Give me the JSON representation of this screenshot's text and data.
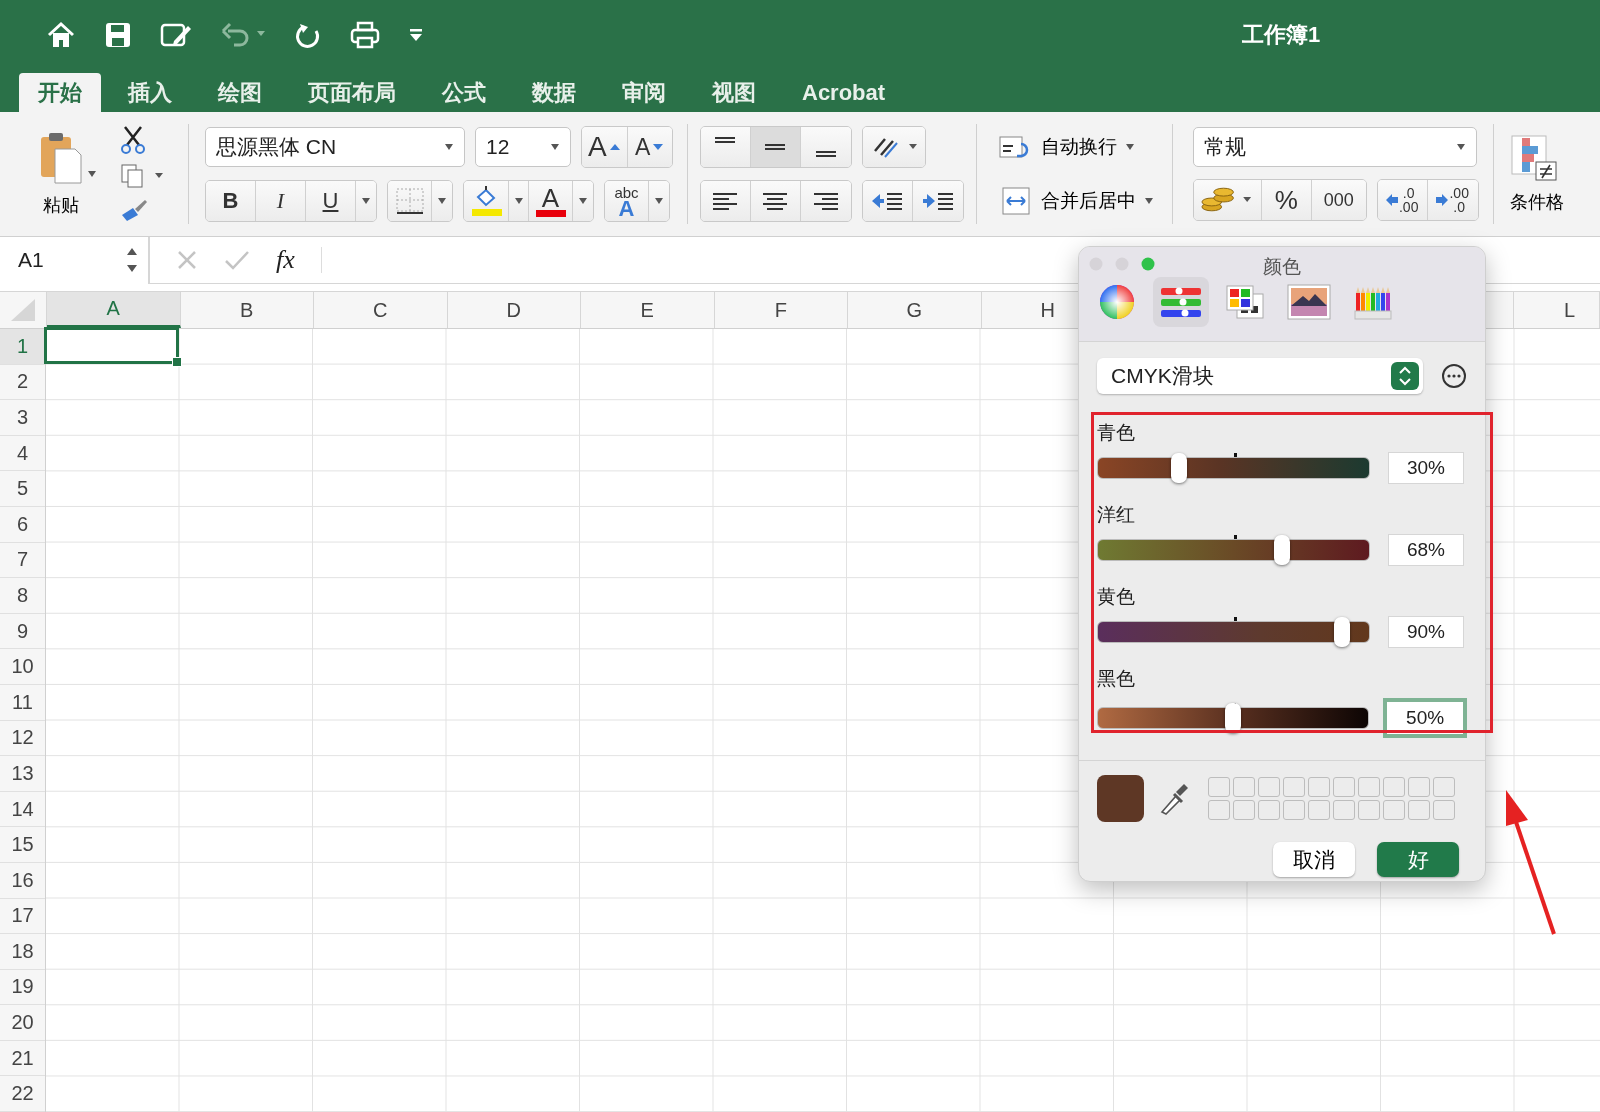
{
  "window": {
    "title": "工作簿1"
  },
  "tabs": [
    {
      "label": "开始",
      "selected": true
    },
    {
      "label": "插入",
      "selected": false
    },
    {
      "label": "绘图",
      "selected": false
    },
    {
      "label": "页面布局",
      "selected": false
    },
    {
      "label": "公式",
      "selected": false
    },
    {
      "label": "数据",
      "selected": false
    },
    {
      "label": "审阅",
      "selected": false
    },
    {
      "label": "视图",
      "selected": false
    },
    {
      "label": "Acrobat",
      "selected": false
    }
  ],
  "ribbon": {
    "paste_label": "粘贴",
    "font_name": "思源黑体 CN",
    "font_size": "12",
    "grow_font": "A",
    "shrink_font": "A",
    "bold": "B",
    "italic": "I",
    "underline": "U",
    "font_color_letter": "A",
    "text_effects": [
      "abc",
      "A"
    ],
    "wrap_text": "自动换行",
    "merge_center": "合并后居中",
    "number_format": "常规",
    "percent": "%",
    "thousands": "000",
    "increase_decimal": [
      ".0",
      ".00"
    ],
    "decrease_decimal": [
      ".00",
      ".0"
    ],
    "conditional_format": "条件格"
  },
  "formula_bar": {
    "name_box": "A1",
    "fx": "fx"
  },
  "sheet": {
    "columns": [
      {
        "label": "A",
        "selected": true
      },
      {
        "label": "B",
        "selected": false
      },
      {
        "label": "C",
        "selected": false
      },
      {
        "label": "D",
        "selected": false
      },
      {
        "label": "E",
        "selected": false
      },
      {
        "label": "F",
        "selected": false
      },
      {
        "label": "G",
        "selected": false
      },
      {
        "label": "H",
        "selected": false
      },
      {
        "label": "L",
        "selected": false
      }
    ],
    "rows": [
      {
        "label": "1",
        "selected": true
      },
      {
        "label": "2",
        "selected": false
      },
      {
        "label": "3",
        "selected": false
      },
      {
        "label": "4",
        "selected": false
      },
      {
        "label": "5",
        "selected": false
      },
      {
        "label": "6",
        "selected": false
      },
      {
        "label": "7",
        "selected": false
      },
      {
        "label": "8",
        "selected": false
      },
      {
        "label": "9",
        "selected": false
      },
      {
        "label": "10",
        "selected": false
      },
      {
        "label": "11",
        "selected": false
      },
      {
        "label": "12",
        "selected": false
      },
      {
        "label": "13",
        "selected": false
      },
      {
        "label": "14",
        "selected": false
      },
      {
        "label": "15",
        "selected": false
      },
      {
        "label": "16",
        "selected": false
      },
      {
        "label": "17",
        "selected": false
      },
      {
        "label": "18",
        "selected": false
      },
      {
        "label": "19",
        "selected": false
      },
      {
        "label": "20",
        "selected": false
      },
      {
        "label": "21",
        "selected": false
      },
      {
        "label": "22",
        "selected": false
      }
    ]
  },
  "color_dialog": {
    "title": "颜色",
    "modes": [
      {
        "kind": "wheel",
        "selected": false
      },
      {
        "kind": "sliders",
        "selected": true
      },
      {
        "kind": "palettes",
        "selected": false
      },
      {
        "kind": "image",
        "selected": false
      },
      {
        "kind": "pencils",
        "selected": false
      }
    ],
    "model": "CMYK滑块",
    "sliders": [
      {
        "label": "青色",
        "level": 0.3,
        "reading": "30%",
        "focused": false
      },
      {
        "label": "洋红",
        "level": 0.68,
        "reading": "68%",
        "focused": false
      },
      {
        "label": "黄色",
        "level": 0.9,
        "reading": "90%",
        "focused": false
      },
      {
        "label": "黑色",
        "level": 0.5,
        "reading": "50%",
        "focused": true
      }
    ],
    "buttons": [
      {
        "label": "取消",
        "kind": "secondary"
      },
      {
        "label": "好",
        "kind": "primary"
      }
    ]
  }
}
